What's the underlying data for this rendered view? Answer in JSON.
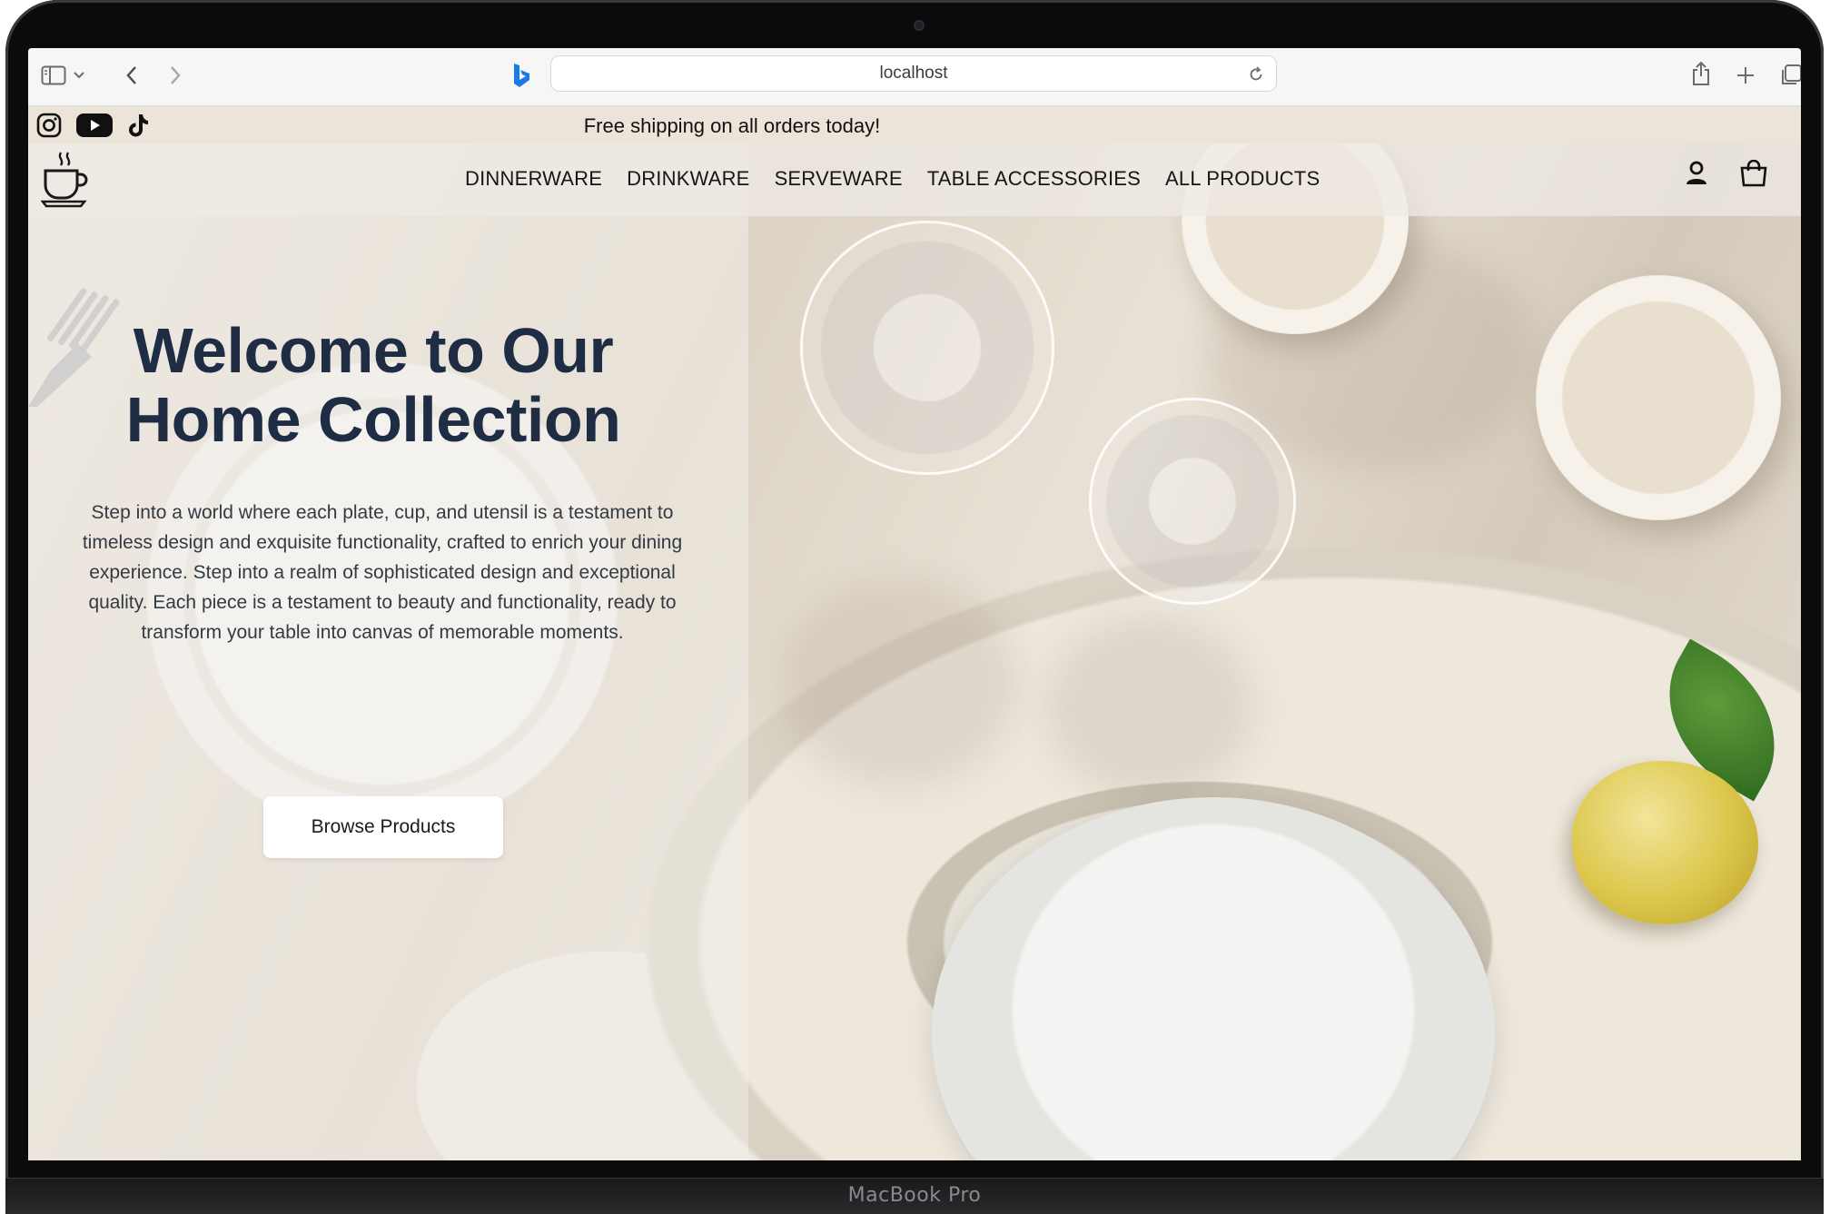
{
  "device": {
    "brand_label": "MacBook Pro"
  },
  "browser": {
    "url": "localhost",
    "icons": [
      "sidebar-icon",
      "chevron-down-icon",
      "back-icon",
      "forward-icon",
      "bing-icon",
      "reload-icon",
      "share-icon",
      "new-tab-icon",
      "tabs-overview-icon"
    ]
  },
  "announcement": {
    "text": "Free shipping on all orders today!",
    "social_icons": [
      "instagram-icon",
      "youtube-icon",
      "tiktok-icon"
    ]
  },
  "nav": {
    "logo_icon": "coffee-cup-icon",
    "links": [
      "DINNERWARE",
      "DRINKWARE",
      "SERVEWARE",
      "TABLE ACCESSORIES",
      "ALL PRODUCTS"
    ],
    "icons": [
      "account-icon",
      "shopping-bag-icon"
    ]
  },
  "hero": {
    "title_line1": "Welcome to Our",
    "title_line2": "Home Collection",
    "description": "Step into a world where each plate, cup, and utensil is a testament to timeless design and exquisite functionality, crafted to enrich your dining experience. Step into a realm of sophisticated design and exceptional quality. Each piece is a testament to beauty and functionality, ready to transform your table into canvas of memorable moments.",
    "cta_label": "Browse Products"
  },
  "colors": {
    "title": "#1e2d44",
    "announcement_bg": "#ece4d8",
    "button_bg": "#ffffff"
  }
}
